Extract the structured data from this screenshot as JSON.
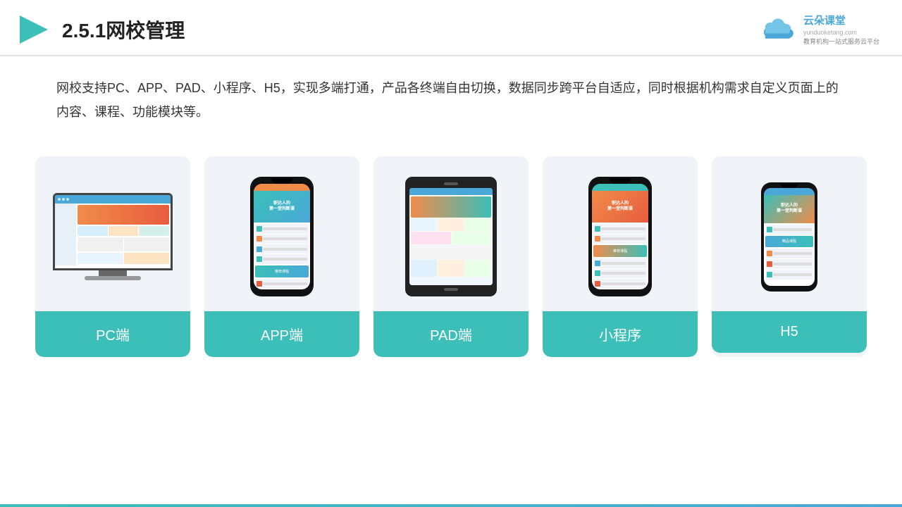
{
  "header": {
    "title": "2.5.1网校管理",
    "logo_name": "云朵课堂",
    "logo_url": "yunduoketang.com",
    "logo_tagline": "教育机构一站式服务云平台"
  },
  "description": {
    "text": "网校支持PC、APP、PAD、小程序、H5，实现多端打通，产品各终端自由切换，数据同步跨平台自适应，同时根据机构需求自定义页面上的内容、课程、功能模块等。"
  },
  "cards": [
    {
      "id": "pc",
      "label": "PC端"
    },
    {
      "id": "app",
      "label": "APP端"
    },
    {
      "id": "pad",
      "label": "PAD端"
    },
    {
      "id": "miniprogram",
      "label": "小程序"
    },
    {
      "id": "h5",
      "label": "H5"
    }
  ],
  "colors": {
    "teal": "#3bbfb8",
    "blue": "#4aa8d8",
    "accent": "#f08c4a"
  }
}
